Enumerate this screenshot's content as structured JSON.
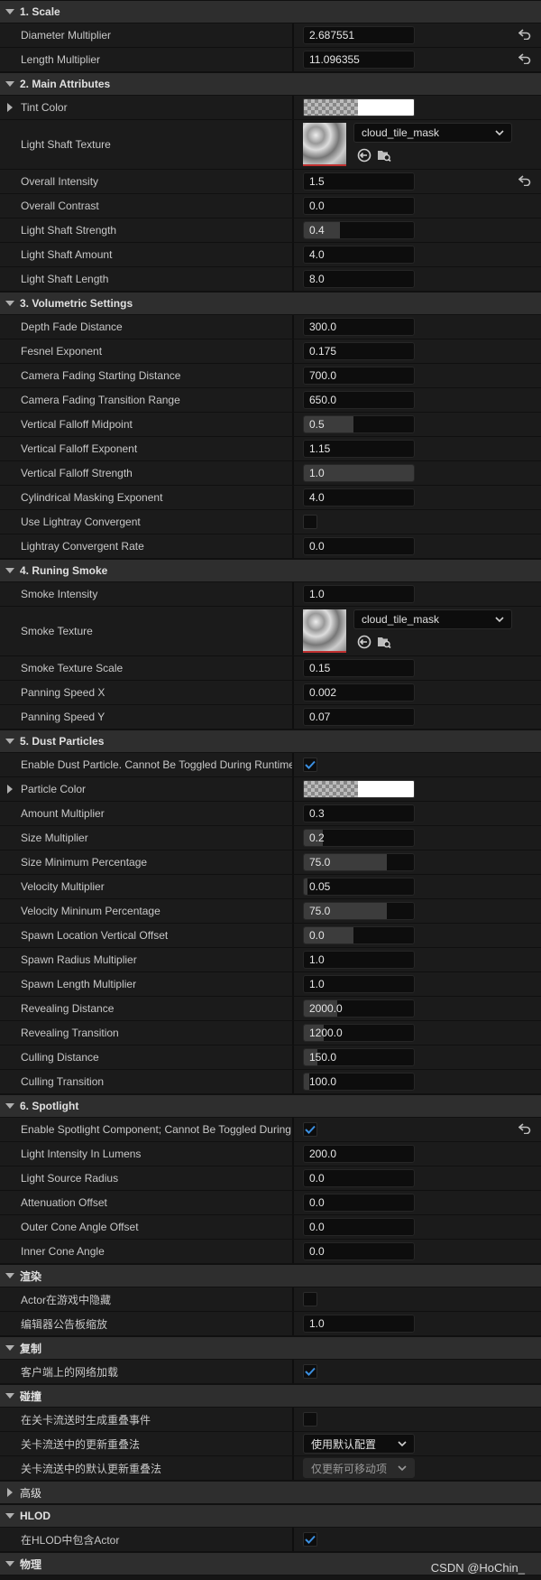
{
  "sections": [
    {
      "title": "1. Scale",
      "rows": [
        {
          "label": "Diameter Multiplier",
          "type": "number",
          "value": "2.687551",
          "reset": true
        },
        {
          "label": "Length Multiplier",
          "type": "number",
          "value": "11.096355",
          "reset": true
        }
      ]
    },
    {
      "title": "2. Main Attributes",
      "rows": [
        {
          "label": "Tint Color",
          "type": "color",
          "expandable": true
        },
        {
          "label": "Light Shaft Texture",
          "type": "texture",
          "value": "cloud_tile_mask"
        },
        {
          "label": "Overall Intensity",
          "type": "number",
          "value": "1.5",
          "reset": true
        },
        {
          "label": "Overall Contrast",
          "type": "number",
          "value": "0.0"
        },
        {
          "label": "Light Shaft Strength",
          "type": "number",
          "value": "0.4",
          "fill": 0.33
        },
        {
          "label": "Light Shaft Amount",
          "type": "number",
          "value": "4.0"
        },
        {
          "label": "Light Shaft Length",
          "type": "number",
          "value": "8.0"
        }
      ]
    },
    {
      "title": "3. Volumetric Settings",
      "rows": [
        {
          "label": "Depth Fade Distance",
          "type": "number",
          "value": "300.0"
        },
        {
          "label": "Fesnel Exponent",
          "type": "number",
          "value": "0.175"
        },
        {
          "label": "Camera Fading Starting Distance",
          "type": "number",
          "value": "700.0"
        },
        {
          "label": "Camera Fading Transition Range",
          "type": "number",
          "value": "650.0"
        },
        {
          "label": "Vertical Falloff Midpoint",
          "type": "number",
          "value": "0.5",
          "fill": 0.45
        },
        {
          "label": "Vertical Falloff Exponent",
          "type": "number",
          "value": "1.15"
        },
        {
          "label": "Vertical Falloff Strength",
          "type": "number",
          "value": "1.0",
          "fill": 1.0
        },
        {
          "label": "Cylindrical Masking Exponent",
          "type": "number",
          "value": "4.0"
        },
        {
          "label": "Use Lightray Convergent",
          "type": "checkbox",
          "checked": false
        },
        {
          "label": "Lightray Convergent Rate",
          "type": "number",
          "value": "0.0"
        }
      ]
    },
    {
      "title": "4. Runing Smoke",
      "rows": [
        {
          "label": "Smoke Intensity",
          "type": "number",
          "value": "1.0"
        },
        {
          "label": "Smoke Texture",
          "type": "texture",
          "value": "cloud_tile_mask"
        },
        {
          "label": "Smoke Texture Scale",
          "type": "number",
          "value": "0.15"
        },
        {
          "label": "Panning Speed X",
          "type": "number",
          "value": "0.002"
        },
        {
          "label": "Panning Speed Y",
          "type": "number",
          "value": "0.07"
        }
      ]
    },
    {
      "title": "5. Dust Particles",
      "rows": [
        {
          "label": "Enable Dust Particle. Cannot Be Toggled During Runtime.",
          "type": "checkbox",
          "checked": true
        },
        {
          "label": "Particle Color",
          "type": "color",
          "expandable": true
        },
        {
          "label": "Amount Multiplier",
          "type": "number",
          "value": "0.3"
        },
        {
          "label": "Size Multiplier",
          "type": "number",
          "value": "0.2",
          "fill": 0.17
        },
        {
          "label": "Size Minimum Percentage",
          "type": "number",
          "value": "75.0",
          "fill": 0.75
        },
        {
          "label": "Velocity Multiplier",
          "type": "number",
          "value": "0.05",
          "fill": 0.03
        },
        {
          "label": "Velocity Mininum Percentage",
          "type": "number",
          "value": "75.0",
          "fill": 0.75
        },
        {
          "label": "Spawn Location Vertical Offset",
          "type": "number",
          "value": "0.0",
          "fill": 0.45
        },
        {
          "label": "Spawn Radius Multiplier",
          "type": "number",
          "value": "1.0"
        },
        {
          "label": "Spawn Length Multiplier",
          "type": "number",
          "value": "1.0"
        },
        {
          "label": "Revealing Distance",
          "type": "number",
          "value": "2000.0",
          "fill": 0.3
        },
        {
          "label": "Revealing Transition",
          "type": "number",
          "value": "1200.0",
          "fill": 0.18
        },
        {
          "label": "Culling Distance",
          "type": "number",
          "value": "150.0",
          "fill": 0.12
        },
        {
          "label": "Culling Transition",
          "type": "number",
          "value": "100.0",
          "fill": 0.05
        }
      ]
    },
    {
      "title": "6. Spotlight",
      "rows": [
        {
          "label": "Enable Spotlight Component; Cannot Be Toggled During Runt...",
          "type": "checkbox",
          "checked": true,
          "reset": true
        },
        {
          "label": "Light Intensity In Lumens",
          "type": "number",
          "value": "200.0"
        },
        {
          "label": "Light Source Radius",
          "type": "number",
          "value": "0.0"
        },
        {
          "label": "Attenuation Offset",
          "type": "number",
          "value": "0.0"
        },
        {
          "label": "Outer Cone Angle Offset",
          "type": "number",
          "value": "0.0"
        },
        {
          "label": "Inner Cone Angle",
          "type": "number",
          "value": "0.0"
        }
      ]
    },
    {
      "title": "渲染",
      "rows": [
        {
          "label": "Actor在游戏中隐藏",
          "type": "checkbox",
          "checked": false
        },
        {
          "label": "编辑器公告板缩放",
          "type": "number",
          "value": "1.0"
        }
      ]
    },
    {
      "title": "复制",
      "rows": [
        {
          "label": "客户端上的网络加载",
          "type": "checkbox",
          "checked": true
        }
      ]
    },
    {
      "title": "碰撞",
      "rows": [
        {
          "label": "在关卡流送时生成重叠事件",
          "type": "checkbox",
          "checked": false
        },
        {
          "label": "关卡流送中的更新重叠法",
          "type": "combo",
          "value": "使用默认配置"
        },
        {
          "label": "关卡流送中的默认更新重叠法",
          "type": "combo",
          "value": "仅更新可移动项",
          "dim": true
        }
      ]
    },
    {
      "title": "高级",
      "collapsed": true,
      "rows": []
    },
    {
      "title": "HLOD",
      "rows": [
        {
          "label": "在HLOD中包含Actor",
          "type": "checkbox",
          "checked": true
        }
      ]
    },
    {
      "title": "物理",
      "rows": []
    }
  ],
  "watermark": "CSDN @HoChin_"
}
